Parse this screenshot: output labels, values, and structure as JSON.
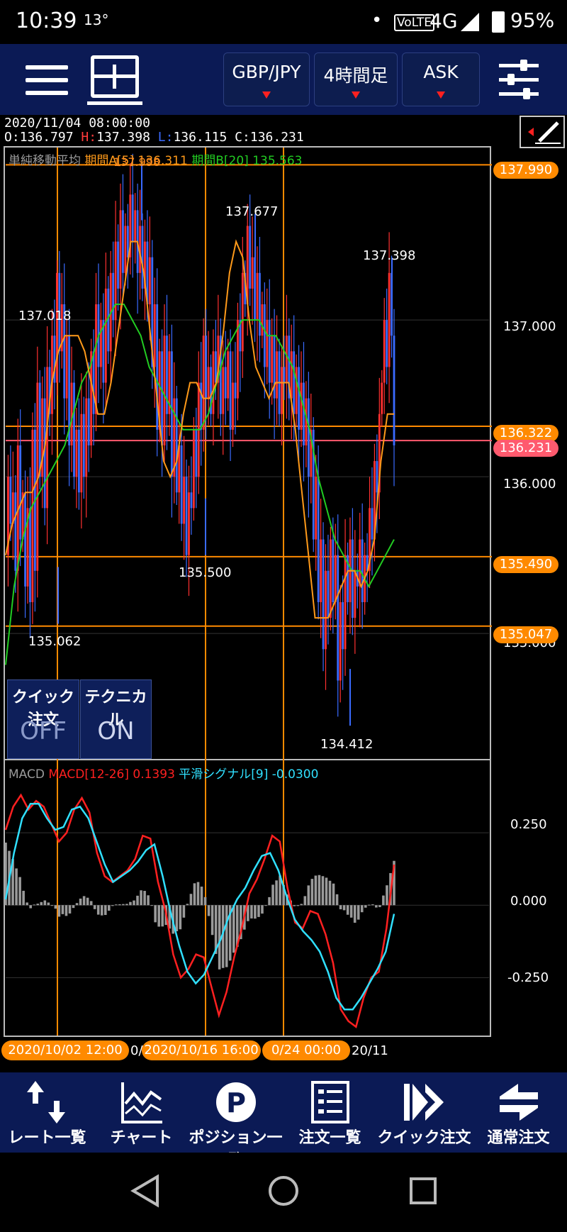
{
  "status_bar": {
    "time": "10:39",
    "temperature": "13°",
    "dot": "•",
    "volte": "VoLTE",
    "network": "4G",
    "battery": "95%"
  },
  "toolbar": {
    "pair": "GBP/JPY",
    "timeframe": "4時間足",
    "price_type": "ASK"
  },
  "ohlc": {
    "datetime": "2020/11/04 08:00:00",
    "open_label": "O:",
    "open": "136.797",
    "high_label": "H:",
    "high": "137.398",
    "low_label": "L:",
    "low": "136.115",
    "close_label": "C:",
    "close": "136.231"
  },
  "sma_legend": {
    "name": "単純移動平均",
    "period_a": "期間A[5] 136.311",
    "period_b": "期間B[20] 135.563",
    "overlap": "137.998"
  },
  "price_axis": {
    "labels": [
      "137.000",
      "136.000",
      "135.000"
    ],
    "tags": [
      {
        "value": "137.990",
        "color": "#ff8a00"
      },
      {
        "value": "136.322",
        "color": "#ff8a00"
      },
      {
        "value": "136.231",
        "color": "#ff5a6e"
      },
      {
        "value": "135.490",
        "color": "#ff8a00"
      },
      {
        "value": "135.047",
        "color": "#ff8a00"
      }
    ]
  },
  "annotations": [
    {
      "text": "137.677",
      "color": "#ff8a1f"
    },
    {
      "text": "137.398",
      "color": "#ff8a1f"
    },
    {
      "text": "137.018",
      "color": "#ff8a1f"
    },
    {
      "text": "135.500",
      "color": "#22cc22"
    },
    {
      "text": "135.062",
      "color": "#22cc22"
    },
    {
      "text": "134.412",
      "color": "#22cc22"
    }
  ],
  "quick_panel": {
    "quick_order": "クイック注文",
    "quick_state": "OFF",
    "technical": "テクニカル",
    "technical_state": "ON"
  },
  "macd_legend": {
    "name": "MACD",
    "macd": "MACD[12-26] 0.1393",
    "signal": "平滑シグナル[9] -0.0300"
  },
  "macd_axis": {
    "labels": [
      "0.250",
      "0.000",
      "-0.250"
    ]
  },
  "time_axis": {
    "labels": [
      "2020/10/02 12:00",
      "0/",
      "2020/10/16 16:00",
      "0/24 00:00",
      "20/11"
    ]
  },
  "bottom_nav": [
    {
      "label": "レート一覧",
      "icon": "rate-list-icon"
    },
    {
      "label": "チャート",
      "icon": "chart-icon"
    },
    {
      "label": "ポジション一覧",
      "icon": "position-icon"
    },
    {
      "label": "注文一覧",
      "icon": "order-list-icon"
    },
    {
      "label": "クイック注文",
      "icon": "quick-order-icon"
    },
    {
      "label": "通常注文",
      "icon": "normal-order-icon"
    }
  ],
  "colors": {
    "toolbar_bg": "#0b1a55",
    "up": "#ff3030",
    "down": "#3a6bff",
    "sma_a": "#ff9a1a",
    "sma_b": "#22cc22",
    "macd": "#ff2020",
    "signal": "#30e0ff",
    "hline": "#ff8a00",
    "current": "#ff5a6e"
  },
  "chart_data": {
    "type": "candlestick",
    "symbol": "GBP/JPY",
    "interval": "4時間足",
    "ylim": [
      134.2,
      138.1
    ],
    "hlines": [
      137.99,
      136.322,
      136.231,
      135.49,
      135.047
    ],
    "extremes": [
      {
        "label": "137.998",
        "value": 137.998,
        "kind": "high"
      },
      {
        "label": "137.677",
        "value": 137.677,
        "kind": "high"
      },
      {
        "label": "137.398",
        "value": 137.398,
        "kind": "high"
      },
      {
        "label": "137.018",
        "value": 137.018,
        "kind": "high"
      },
      {
        "label": "135.500",
        "value": 135.5,
        "kind": "low"
      },
      {
        "label": "135.062",
        "value": 135.062,
        "kind": "low"
      },
      {
        "label": "134.412",
        "value": 134.412,
        "kind": "low"
      }
    ],
    "close_path": [
      135.5,
      136.0,
      135.7,
      135.9,
      135.4,
      136.2,
      135.6,
      135.9,
      135.3,
      135.8,
      135.2,
      136.3,
      135.4,
      136.6,
      136.0,
      136.5,
      135.8,
      136.7,
      136.4,
      136.9,
      136.6,
      137.3,
      136.8,
      137.1,
      136.5,
      136.9,
      136.2,
      136.6,
      136.0,
      136.3,
      135.9,
      136.4,
      136.0,
      136.5,
      136.2,
      136.8,
      136.4,
      137.1,
      136.7,
      137.0,
      136.6,
      137.2,
      136.8,
      137.3,
      137.0,
      137.5,
      137.2,
      137.7,
      137.3,
      137.6,
      137.4,
      137.8,
      137.5,
      137.7,
      137.3,
      137.6,
      137.2,
      137.5,
      137.1,
      137.4,
      136.7,
      137.1,
      136.3,
      136.8,
      136.2,
      136.9,
      136.4,
      136.8,
      136.0,
      136.5,
      135.9,
      136.2,
      135.7,
      136.0,
      135.5,
      135.9,
      135.8,
      136.3,
      136.0,
      136.6,
      136.3,
      136.9,
      136.5,
      136.7,
      136.4,
      136.8,
      136.6,
      136.9,
      136.4,
      136.7,
      136.5,
      136.8,
      136.3,
      136.6,
      136.5,
      137.0,
      136.8,
      137.3,
      137.1,
      137.6,
      137.2,
      137.4,
      137.0,
      137.3,
      136.9,
      137.1,
      136.7,
      137.0,
      136.6,
      136.9,
      136.5,
      136.8,
      136.4,
      136.7,
      136.6,
      136.9,
      136.5,
      136.8,
      136.4,
      136.7,
      136.3,
      136.6,
      136.2,
      136.5,
      136.0,
      136.3,
      135.6,
      136.0,
      135.2,
      135.6,
      134.9,
      135.4,
      135.1,
      135.6,
      135.2,
      135.5,
      134.7,
      135.2,
      134.9,
      135.5,
      135.2,
      135.6,
      135.1,
      135.4,
      135.3,
      135.6,
      135.2,
      135.5,
      135.4,
      135.8,
      135.6,
      136.1,
      135.9,
      136.4,
      136.6,
      137.0,
      136.7,
      137.3,
      136.9,
      136.2
    ],
    "sma_a": [
      135.5,
      135.7,
      135.8,
      135.9,
      135.9,
      136.0,
      136.2,
      136.6,
      136.8,
      136.9,
      136.9,
      136.9,
      136.8,
      136.6,
      136.4,
      136.4,
      136.6,
      136.9,
      137.2,
      137.5,
      137.5,
      137.3,
      136.9,
      136.5,
      136.1,
      136.0,
      136.1,
      136.4,
      136.6,
      136.6,
      136.5,
      136.5,
      136.6,
      136.9,
      137.3,
      137.5,
      137.4,
      137.0,
      136.7,
      136.6,
      136.5,
      136.6,
      136.6,
      136.6,
      136.3,
      135.9,
      135.5,
      135.1,
      135.1,
      135.1,
      135.2,
      135.3,
      135.4,
      135.4,
      135.3,
      135.4,
      135.6,
      136.1,
      136.4,
      136.4
    ],
    "sma_b": [
      134.8,
      135.3,
      135.6,
      135.8,
      135.9,
      136.0,
      136.1,
      136.2,
      136.4,
      136.6,
      136.7,
      136.9,
      137.0,
      137.1,
      137.1,
      137.0,
      136.9,
      136.7,
      136.6,
      136.5,
      136.4,
      136.3,
      136.3,
      136.3,
      136.4,
      136.6,
      136.8,
      136.9,
      137.0,
      137.0,
      137.0,
      136.9,
      136.9,
      136.8,
      136.7,
      136.5,
      136.3,
      136.0,
      135.8,
      135.6,
      135.5,
      135.4,
      135.4,
      135.3,
      135.4,
      135.5,
      135.6
    ]
  },
  "macd_data": {
    "ylim": [
      -0.45,
      0.5
    ],
    "macd": [
      0.26,
      0.34,
      0.38,
      0.33,
      0.36,
      0.34,
      0.28,
      0.22,
      0.25,
      0.33,
      0.37,
      0.32,
      0.18,
      0.1,
      0.08,
      0.1,
      0.12,
      0.16,
      0.24,
      0.23,
      0.08,
      -0.02,
      -0.17,
      -0.25,
      -0.22,
      -0.17,
      -0.18,
      -0.28,
      -0.38,
      -0.3,
      -0.18,
      -0.08,
      0.04,
      0.09,
      0.16,
      0.24,
      0.22,
      0.06,
      -0.06,
      -0.08,
      -0.02,
      -0.03,
      -0.1,
      -0.2,
      -0.36,
      -0.4,
      -0.42,
      -0.32,
      -0.25,
      -0.23,
      -0.08,
      0.14
    ],
    "signal": [
      0.02,
      0.18,
      0.3,
      0.35,
      0.35,
      0.3,
      0.26,
      0.27,
      0.33,
      0.34,
      0.3,
      0.22,
      0.14,
      0.08,
      0.1,
      0.12,
      0.15,
      0.19,
      0.21,
      0.1,
      -0.03,
      -0.14,
      -0.23,
      -0.27,
      -0.24,
      -0.18,
      -0.12,
      -0.04,
      0.02,
      0.06,
      0.12,
      0.17,
      0.18,
      0.12,
      0.03,
      -0.05,
      -0.09,
      -0.12,
      -0.16,
      -0.23,
      -0.32,
      -0.36,
      -0.36,
      -0.32,
      -0.27,
      -0.22,
      -0.16,
      -0.03
    ]
  }
}
